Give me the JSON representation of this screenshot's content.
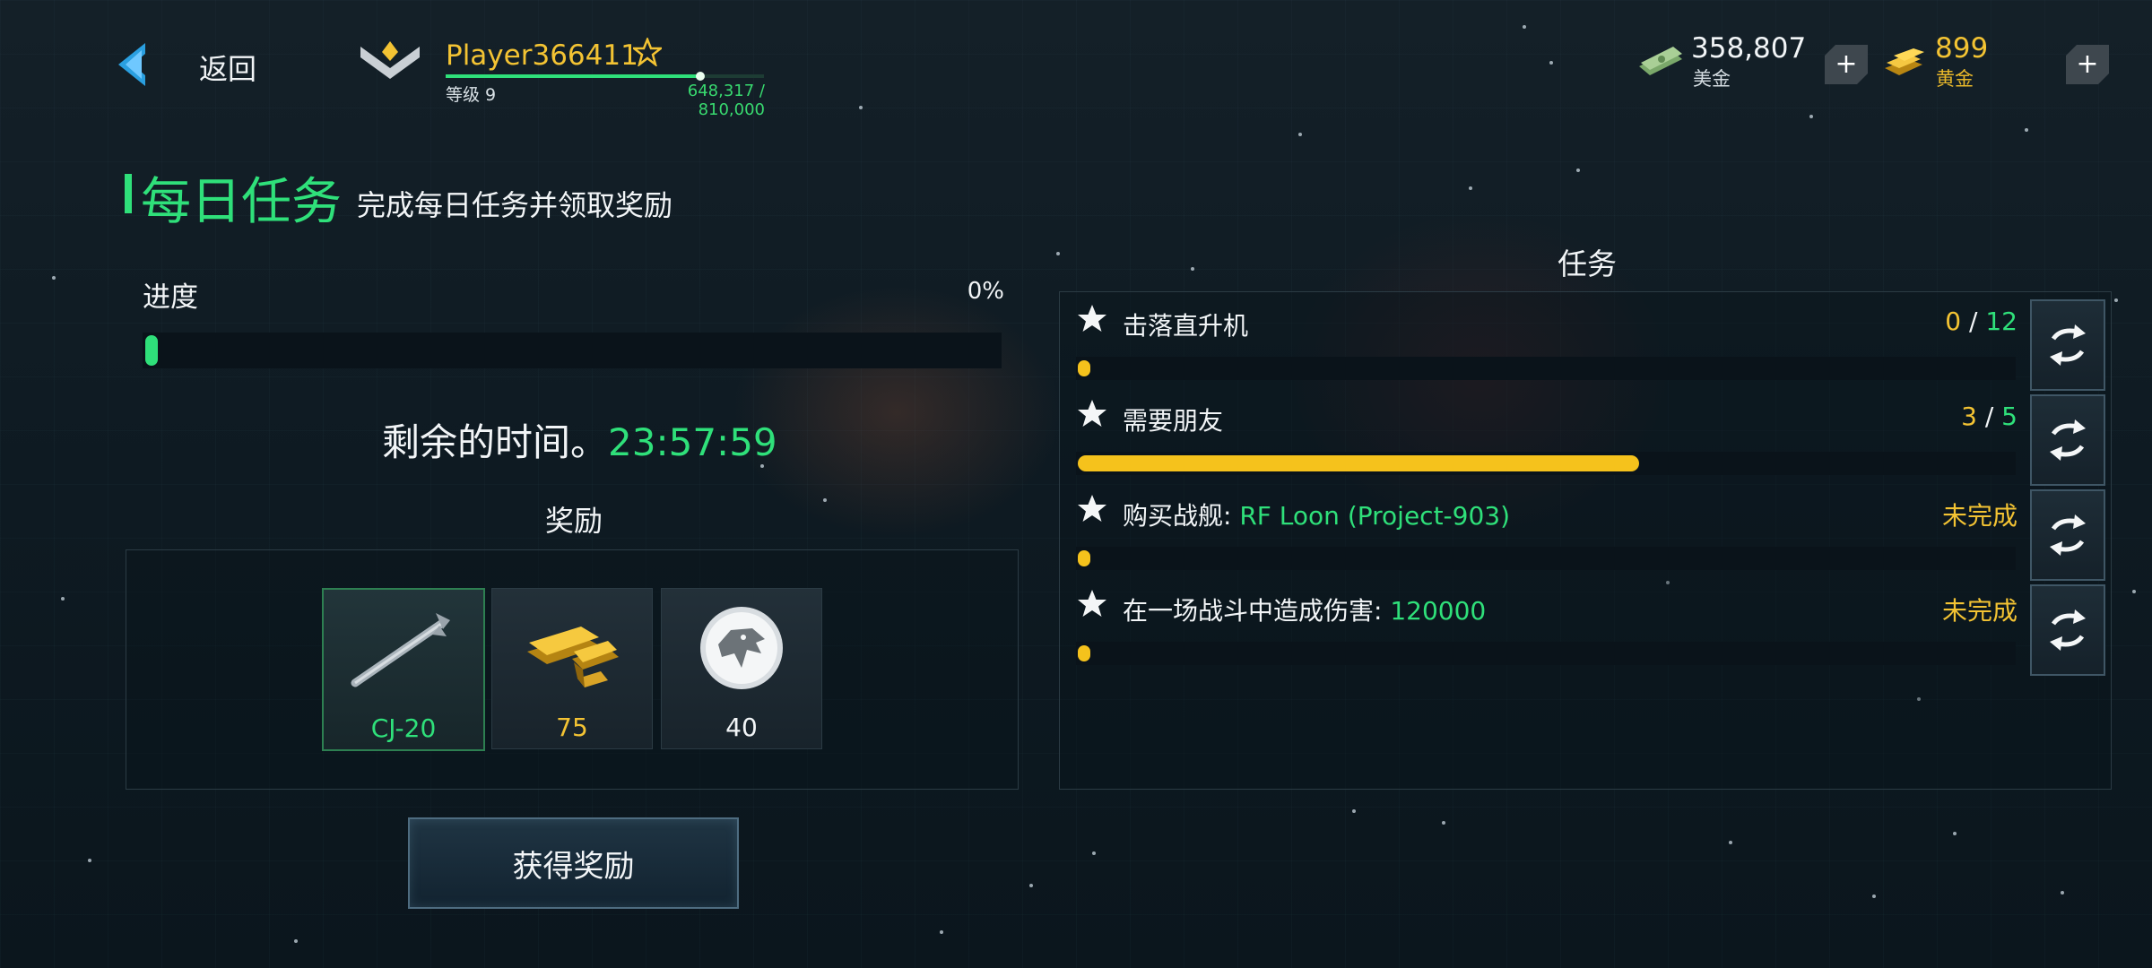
{
  "header": {
    "back_label": "返回",
    "player_name": "Player366411",
    "level": "等级 9",
    "xp_text": "648,317 / 810,000",
    "xp_progress": 0.8
  },
  "currency": {
    "cash_value": "358,807",
    "cash_label": "美金",
    "gold_value": "899",
    "gold_label": "黄金",
    "plus": "+"
  },
  "daily": {
    "title": "每日任务",
    "subtitle": "完成每日任务并领取奖励",
    "progress_label": "进度",
    "progress_pct": "0%",
    "time_label": "剩余的时间。",
    "time_value": "23:57:59",
    "rewards_title": "奖励",
    "rewards": [
      {
        "label": "CJ-20",
        "icon": "missile-icon",
        "color": "#2fe07a"
      },
      {
        "label": "75",
        "icon": "gold-bars-icon",
        "color": "#f3c333"
      },
      {
        "label": "40",
        "icon": "eagle-emblem-icon",
        "color": "#f2f5f7"
      }
    ],
    "claim_button": "获得奖励"
  },
  "tasks": {
    "title": "任务",
    "items": [
      {
        "label": "击落直升机",
        "highlight": "",
        "status_current": "0",
        "status_sep": " / ",
        "status_total": "12",
        "progress": 0.0,
        "complete_text": ""
      },
      {
        "label": "需要朋友",
        "highlight": "",
        "status_current": "3",
        "status_sep": " / ",
        "status_total": "5",
        "progress": 0.6,
        "complete_text": ""
      },
      {
        "label": "购买战舰: ",
        "highlight": "RF Loon (Project-903)",
        "status_current": "",
        "status_sep": "",
        "status_total": "",
        "progress": 0.0,
        "complete_text": "未完成"
      },
      {
        "label": "在一场战斗中造成伤害: ",
        "highlight": "120000",
        "status_current": "",
        "status_sep": "",
        "status_total": "",
        "progress": 0.0,
        "complete_text": "未完成"
      }
    ]
  },
  "colors": {
    "accent_green": "#2fe07a",
    "accent_yellow": "#f3c333",
    "progress_yellow": "#f5c21c"
  }
}
